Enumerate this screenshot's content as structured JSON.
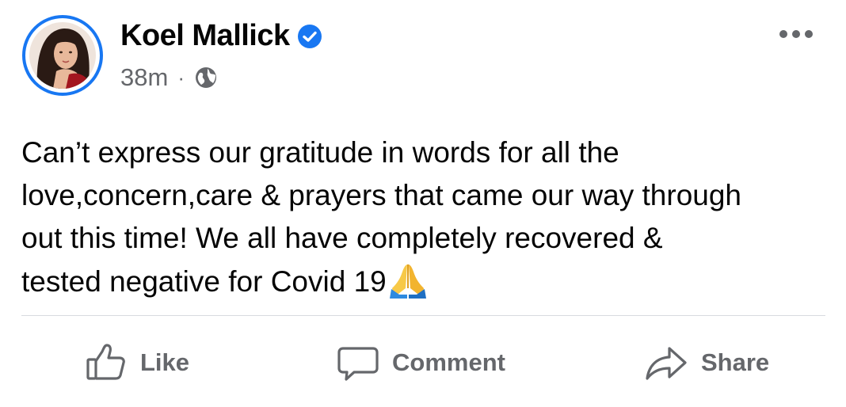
{
  "post": {
    "author": {
      "name": "Koel Mallick",
      "verified": true
    },
    "meta": {
      "time": "38m",
      "separator": "·",
      "audience_icon": "globe-icon"
    },
    "text": "Can’t express our gratitude in words for all the\nlove,concern,care & prayers that came our way through\nout this time! We all have completely recovered &\ntested negative for Covid 19",
    "emoji": "folded-hands-icon",
    "menu_icon": "more-options-icon"
  },
  "actions": {
    "like": "Like",
    "comment": "Comment",
    "share": "Share"
  },
  "colors": {
    "accent": "#1877f2",
    "secondary_text": "#65676b",
    "primary_text": "#050505",
    "divider": "#d8dadf"
  }
}
